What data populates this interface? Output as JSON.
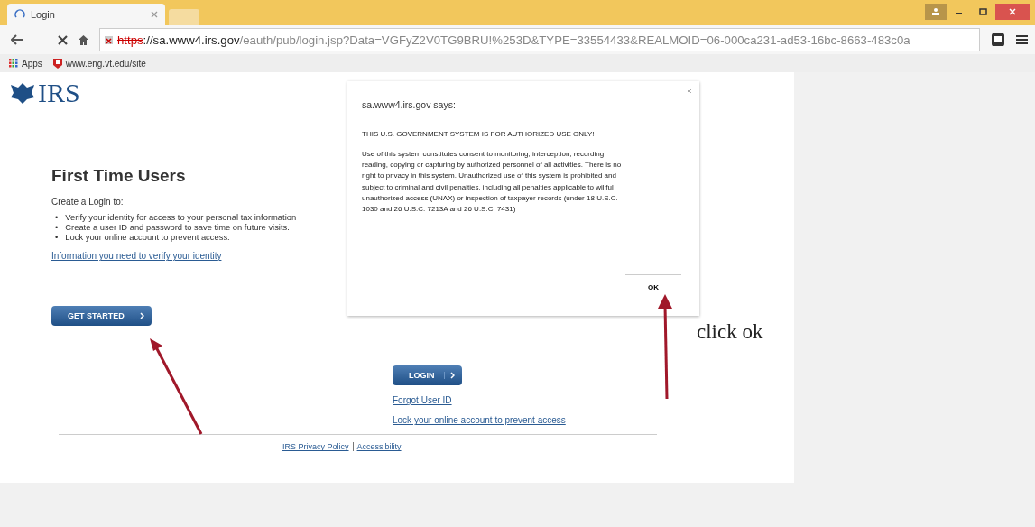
{
  "browser": {
    "tab": {
      "title": "Login",
      "selected": true
    },
    "url": {
      "scheme": "https",
      "host": "://sa.www4.irs.gov",
      "path": "/eauth/pub/login.jsp?Data=VGFyZ2V0TG9BRU!%253D&TYPE=33554433&REALMOID=06-000ca231-ad53-16bc-8663-483c0a"
    },
    "bookmarks": [
      {
        "label": "Apps",
        "kind": "apps"
      },
      {
        "label": "www.eng.vt.edu/site",
        "kind": "site"
      }
    ]
  },
  "page": {
    "logo": "IRS",
    "first_time": {
      "heading": "First Time Users",
      "intro": "Create a Login to:",
      "bullet_marker": "•",
      "bullets": [
        "Verify your identity for access to your personal tax information",
        "Create a user ID and password to save time on future visits.",
        "Lock your online account to prevent access."
      ],
      "link": "Information you need to verify your identity",
      "button": "GET STARTED"
    },
    "login": {
      "button": "LOGIN",
      "links": [
        "Forgot User ID",
        "Lock your online account to prevent access"
      ]
    },
    "footer_links": [
      "IRS Privacy Policy",
      "Accessibility"
    ]
  },
  "dialog": {
    "title": "sa.www4.irs.gov says:",
    "heading": "THIS U.S. GOVERNMENT SYSTEM IS FOR AUTHORIZED USE ONLY!",
    "body": "Use of this system constitutes consent to monitoring, interception, recording, reading, copying or capturing by authorized personnel of all activities. There is no right to privacy in this system. Unauthorized use of this system is prohibited and subject to criminal and civil penalties, including all penalties applicable to willful unauthorized access (UNAX) or inspection of taxpayer records (under 18 U.S.C. 1030 and 26 U.S.C. 7213A and 26 U.S.C. 7431)",
    "ok": "OK"
  },
  "annotation": {
    "text": "click ok"
  }
}
